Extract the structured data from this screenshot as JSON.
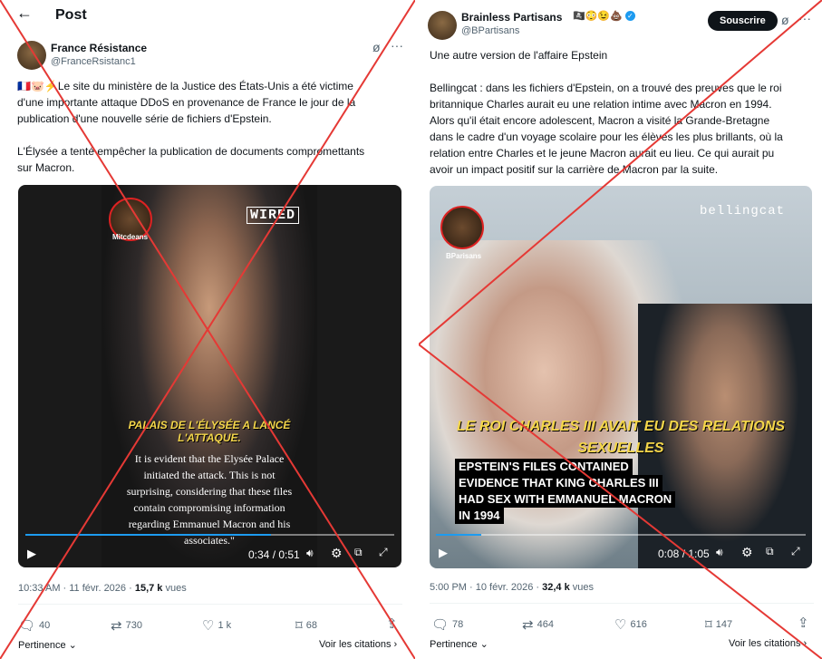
{
  "left": {
    "header": {
      "title": "Post",
      "back_icon": "arrow-left-icon"
    },
    "author": {
      "name": "France Résistance",
      "handle": "@FranceRsistanc1"
    },
    "text_lines": [
      "🇫🇷🐷⚡Le site du ministère de la Justice des États-Unis a été victime",
      "d'une importante attaque DDoS en provenance de France le jour de la",
      "publication d'une nouvelle série de fichiers d'Epstein."
    ],
    "text_lines_2": [
      "L'Élysée a tenté empêcher la publication de documents compromettants",
      "sur Macron."
    ],
    "video": {
      "watermark": "WIRED",
      "logo_text": "Mitcdeans",
      "yellow_caption": "PALAIS DE L'ÉLYSÉE A LANCÉ L'ATTAQUE.",
      "white_caption": [
        "It is evident that the Elysée Palace",
        "initiated the attack. This is not",
        "surprising, considering that these files",
        "contain compromising information",
        "regarding Emmanuel Macron and his",
        "associates.\""
      ],
      "time": "0:34 / 0:51",
      "progress": 0.667
    },
    "meta": {
      "time": "10:33 AM · 11 févr. 2026 · ",
      "views_count": "15,7 k",
      "views_label": " vues"
    },
    "actions": {
      "replies": "40",
      "reposts": "730",
      "likes": "1 k",
      "bookmarks": "68"
    },
    "footer": {
      "sort": "Pertinence",
      "quotes": "Voir les citations"
    }
  },
  "right": {
    "author": {
      "name": "Brainless Partisans",
      "handle": "@BPartisans",
      "emojis": "🏴‍☠️😳😉💩"
    },
    "subscribe_label": "Souscrire",
    "text_intro": "Une autre version de l'affaire Epstein",
    "text_lines": [
      "Bellingcat : dans les fichiers d'Epstein, on a trouvé des preuves que le roi",
      "britannique Charles aurait eu une relation intime avec Macron en 1994.",
      "Alors qu'il était encore adolescent, Macron a visité la Grande-Bretagne",
      "dans le cadre d'un voyage scolaire pour les élèves les plus brillants, où la",
      "relation entre Charles et le jeune Macron aurait eu lieu. Ce qui aurait pu",
      "avoir un impact positif sur la carrière de Macron par la suite."
    ],
    "video": {
      "watermark": "bellingcat",
      "logo_text": "BParisans",
      "yellow_caption": [
        "LE ROI CHARLES III AVAIT EU DES RELATIONS",
        "SEXUELLES"
      ],
      "black_caption": [
        "EPSTEIN'S FILES CONTAINED",
        "EVIDENCE THAT KING CHARLES III",
        "HAD SEX WITH EMMANUEL MACRON",
        "IN 1994"
      ],
      "time": "0:08 / 1:05",
      "progress": 0.123
    },
    "meta": {
      "time": "5:00 PM · 10 févr. 2026 · ",
      "views_count": "32,4 k",
      "views_label": " vues"
    },
    "actions": {
      "replies": "78",
      "reposts": "464",
      "likes": "616",
      "bookmarks": "147"
    },
    "footer": {
      "sort": "Pertinence",
      "quotes": "Voir les citations"
    }
  },
  "colors": {
    "cross": "#e53935",
    "accent": "#1d9bf0",
    "yellow_caption": "#f4d64a"
  }
}
